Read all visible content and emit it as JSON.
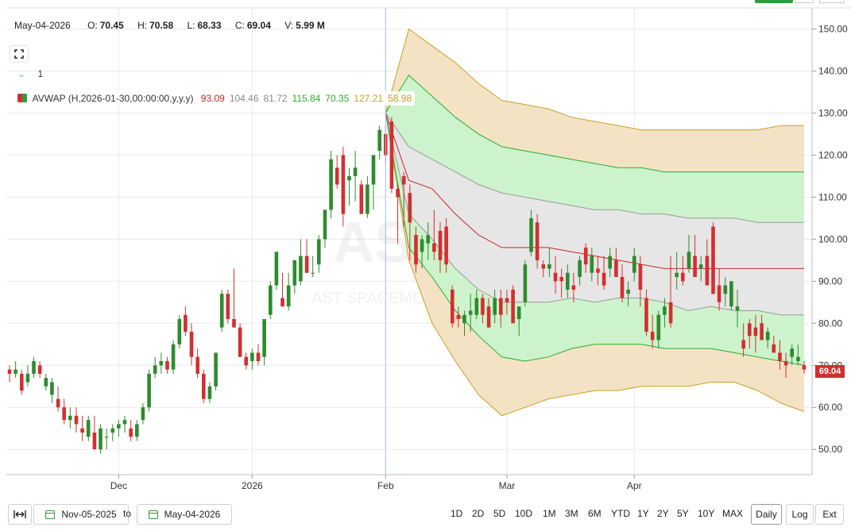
{
  "header": {
    "date": "May-04-2026",
    "open_label": "O:",
    "open": "70.45",
    "high_label": "H:",
    "high": "70.58",
    "low_label": "L:",
    "low": "68.33",
    "close_label": "C:",
    "close": "69.04",
    "volume_label": "V:",
    "volume": "5.99 M"
  },
  "study_count": "1",
  "legend": {
    "name": "AVWAP (H,2026-01-30,00:00:00,y,y,y)",
    "values": [
      {
        "text": "93.09",
        "color": "#c62828"
      },
      {
        "text": "104.46",
        "color": "#8a8a8a"
      },
      {
        "text": "81.72",
        "color": "#8a8a8a"
      },
      {
        "text": "115.84",
        "color": "#2eaa2e"
      },
      {
        "text": "70.35",
        "color": "#2eaa2e"
      },
      {
        "text": "127.21",
        "color": "#c8a02a"
      },
      {
        "text": "58.98",
        "color": "#c8a02a"
      }
    ]
  },
  "watermark": {
    "ticker": "ASTS",
    "name": "AST SPACEMOBILE"
  },
  "last_price": "69.04",
  "toolbar": {
    "start_date": "Nov-05-2025",
    "to_label": "to",
    "end_date": "May-04-2026",
    "ranges": [
      "1D",
      "2D",
      "5D",
      "10D",
      "1M",
      "3M",
      "6M",
      "YTD",
      "1Y",
      "2Y",
      "5Y",
      "10Y",
      "MAX"
    ],
    "interval": "Daily",
    "log_label": "Log",
    "ext_label": "Ext"
  },
  "colors": {
    "up": "#2e8b2e",
    "down": "#d32f2f",
    "vwap": "#c62828",
    "band1": "#9a9a9a",
    "band2": "#2eaa2e",
    "band3": "#c8a02a",
    "fill1": "#e6e6e6",
    "fill2": "#cdf3cd",
    "fill3": "#f3e3c4"
  },
  "chart_data": {
    "type": "candlestick",
    "title": "",
    "ylim": [
      44,
      155
    ],
    "y_ticks": [
      50,
      60,
      70,
      80,
      90,
      100,
      110,
      120,
      130,
      140,
      150
    ],
    "y_tick_labels": [
      "50.00",
      "60.00",
      "70.00",
      "80.00",
      "90.00",
      "100.00",
      "110.00",
      "120.00",
      "130.00",
      "140.00",
      "150.00"
    ],
    "x_tick_labels": [
      "Dec",
      "2026",
      "Feb",
      "Mar",
      "Apr"
    ],
    "x_tick_index": [
      18,
      40,
      62,
      82,
      103
    ],
    "candles": [
      [
        69,
        70,
        66,
        68
      ],
      [
        68,
        71,
        67,
        69
      ],
      [
        68,
        69,
        63,
        64
      ],
      [
        66,
        70,
        65,
        68
      ],
      [
        68,
        72,
        67,
        71
      ],
      [
        70,
        71,
        67,
        68
      ],
      [
        65,
        68,
        64,
        67
      ],
      [
        63,
        67,
        61,
        66
      ],
      [
        62,
        65,
        59,
        60
      ],
      [
        60,
        62,
        56,
        57
      ],
      [
        57,
        60,
        55,
        58
      ],
      [
        58,
        60,
        54,
        56
      ],
      [
        55,
        58,
        52,
        54
      ],
      [
        53,
        58,
        52,
        57
      ],
      [
        54,
        58,
        51,
        50
      ],
      [
        50,
        56,
        49,
        55
      ],
      [
        53,
        55,
        50,
        53
      ],
      [
        54,
        56,
        52,
        55
      ],
      [
        55,
        57,
        53,
        56
      ],
      [
        56,
        58,
        54,
        57
      ],
      [
        55,
        57,
        52,
        53
      ],
      [
        53,
        57,
        52,
        56
      ],
      [
        57,
        61,
        56,
        60
      ],
      [
        60,
        69,
        59,
        68
      ],
      [
        68,
        72,
        67,
        70
      ],
      [
        70,
        73,
        68,
        71
      ],
      [
        71,
        72,
        68,
        69
      ],
      [
        69,
        76,
        68,
        75
      ],
      [
        75,
        82,
        74,
        81
      ],
      [
        82,
        84,
        77,
        78
      ],
      [
        78,
        80,
        70,
        72
      ],
      [
        72,
        74,
        67,
        68
      ],
      [
        68,
        69,
        61,
        62
      ],
      [
        62,
        66,
        61,
        65
      ],
      [
        65,
        73,
        64,
        73
      ],
      [
        79,
        88,
        78,
        87
      ],
      [
        87,
        88,
        80,
        81
      ],
      [
        81,
        93,
        79,
        79
      ],
      [
        79,
        80,
        72,
        72
      ],
      [
        72,
        73,
        69,
        70
      ],
      [
        71,
        74,
        69,
        73
      ],
      [
        73,
        75,
        70,
        71
      ],
      [
        72,
        80,
        70,
        81
      ],
      [
        82,
        90,
        81,
        89
      ],
      [
        89,
        97,
        88,
        97
      ],
      [
        86,
        92,
        84,
        84
      ],
      [
        84,
        92,
        83,
        89
      ],
      [
        89,
        95,
        87,
        95
      ],
      [
        90,
        100,
        89,
        96
      ],
      [
        96,
        100,
        92,
        92
      ],
      [
        92,
        96,
        91,
        92
      ],
      [
        94,
        101,
        92,
        100
      ],
      [
        100,
        107,
        98,
        107
      ],
      [
        107,
        121,
        105,
        119
      ],
      [
        117,
        120,
        112,
        113
      ],
      [
        120,
        122,
        103,
        106
      ],
      [
        114,
        117,
        108,
        115
      ],
      [
        115,
        121,
        109,
        117
      ],
      [
        113,
        114,
        106,
        106
      ],
      [
        106,
        115,
        105,
        113
      ],
      [
        113,
        119,
        107,
        120
      ],
      [
        121,
        127,
        119,
        126
      ],
      [
        125,
        127,
        118,
        120
      ],
      [
        128,
        129,
        111,
        112
      ],
      [
        112,
        113,
        99,
        110
      ],
      [
        115,
        116,
        103,
        113
      ],
      [
        111,
        113,
        95,
        104
      ],
      [
        101,
        103,
        92,
        94
      ],
      [
        97,
        101,
        93,
        100
      ],
      [
        99,
        104,
        95,
        101
      ],
      [
        99,
        107,
        95,
        97
      ],
      [
        102,
        104,
        92,
        95
      ],
      [
        103,
        105,
        92,
        94
      ],
      [
        88,
        89,
        79,
        80
      ],
      [
        82,
        84,
        79,
        81
      ],
      [
        80,
        83,
        77,
        82
      ],
      [
        82,
        87,
        78,
        83
      ],
      [
        82,
        88,
        81,
        86
      ],
      [
        86,
        87,
        80,
        82
      ],
      [
        84,
        86,
        79,
        79
      ],
      [
        82,
        88,
        80,
        86
      ],
      [
        86,
        88,
        79,
        82
      ],
      [
        86,
        88,
        82,
        85
      ],
      [
        88,
        89,
        81,
        80
      ],
      [
        81,
        83,
        77,
        84
      ],
      [
        85,
        95,
        84,
        94
      ],
      [
        97,
        107,
        96,
        105
      ],
      [
        104,
        106,
        93,
        95
      ],
      [
        94,
        95,
        91,
        93
      ],
      [
        93,
        98,
        91,
        94
      ],
      [
        92,
        96,
        87,
        90
      ],
      [
        91,
        93,
        86,
        90
      ],
      [
        88,
        94,
        86,
        92
      ],
      [
        89,
        92,
        85,
        88
      ],
      [
        91,
        96,
        89,
        95
      ],
      [
        98,
        99,
        92,
        94
      ],
      [
        92,
        98,
        90,
        96
      ],
      [
        93,
        96,
        89,
        92
      ],
      [
        92,
        96,
        88,
        89
      ],
      [
        93,
        98,
        91,
        96
      ],
      [
        95,
        98,
        91,
        91
      ],
      [
        91,
        94,
        85,
        86
      ],
      [
        87,
        90,
        84,
        88
      ],
      [
        92,
        98,
        90,
        96
      ],
      [
        94,
        96,
        84,
        88
      ],
      [
        86,
        88,
        77,
        78
      ],
      [
        78,
        82,
        74,
        76
      ],
      [
        76,
        83,
        74,
        82
      ],
      [
        82,
        86,
        79,
        84
      ],
      [
        85,
        96,
        79,
        80
      ],
      [
        91,
        97,
        88,
        92
      ],
      [
        92,
        96,
        89,
        90
      ],
      [
        93,
        101,
        92,
        97
      ],
      [
        96,
        101,
        91,
        91
      ],
      [
        93,
        96,
        90,
        94
      ],
      [
        96,
        100,
        92,
        89
      ],
      [
        103,
        104,
        87,
        87
      ],
      [
        89,
        93,
        83,
        85
      ],
      [
        87,
        91,
        84,
        89
      ],
      [
        84,
        90,
        83,
        90
      ],
      [
        83,
        88,
        79,
        84
      ],
      [
        76,
        80,
        72,
        74
      ],
      [
        80,
        81,
        74,
        77
      ],
      [
        79,
        82,
        73,
        77
      ],
      [
        80,
        82,
        76,
        76
      ],
      [
        76,
        79,
        74,
        78
      ],
      [
        75,
        77,
        73,
        73
      ],
      [
        73,
        76,
        69,
        71
      ],
      [
        71,
        73,
        67,
        70
      ],
      [
        72,
        75,
        70,
        74
      ],
      [
        71,
        75,
        70,
        72
      ],
      [
        70,
        71,
        68,
        69
      ]
    ],
    "anchor_index": 62,
    "vwap": [
      130,
      114,
      112,
      106,
      101,
      98,
      98,
      98,
      97,
      96,
      95,
      94,
      93,
      93,
      93,
      93,
      93,
      93,
      93
    ],
    "band1_upper": [
      130,
      122,
      119,
      116,
      113,
      111,
      110,
      109,
      108,
      107,
      107,
      106,
      106,
      105,
      105,
      105,
      104,
      104,
      104
    ],
    "band1_lower": [
      130,
      106,
      100,
      93,
      88,
      85,
      85,
      85,
      86,
      85,
      86,
      86,
      85,
      83,
      84,
      83,
      83,
      82,
      82
    ],
    "band2_upper": [
      130,
      139,
      134,
      129,
      125,
      122,
      121,
      120,
      119,
      118,
      117,
      117,
      116,
      116,
      116,
      116,
      116,
      116,
      116
    ],
    "band2_lower": [
      130,
      98,
      91,
      83,
      77,
      72,
      71,
      72,
      74,
      75,
      75,
      75,
      74,
      74,
      74,
      73,
      72,
      71,
      70
    ],
    "band3_upper": [
      130,
      150,
      146,
      142,
      137,
      133,
      132,
      131,
      129,
      128,
      127,
      126,
      126,
      126,
      126,
      126,
      126,
      127,
      127
    ],
    "band3_lower": [
      130,
      95,
      80,
      71,
      63,
      58,
      60,
      62,
      63,
      64,
      64,
      65,
      65,
      65,
      66,
      66,
      64,
      61,
      59
    ]
  }
}
